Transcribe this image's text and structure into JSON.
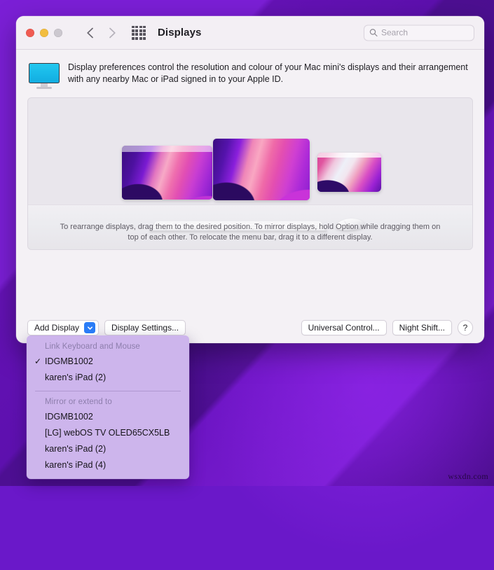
{
  "window": {
    "title": "Displays",
    "traffic_lights": [
      "close",
      "minimize",
      "zoom"
    ],
    "back_icon": "chevron-left-icon",
    "forward_icon": "chevron-right-icon",
    "grid_icon": "grid-apps-icon"
  },
  "search": {
    "placeholder": "Search",
    "value": "",
    "icon": "search-icon"
  },
  "blurb": {
    "icon": "display-monitor-icon",
    "text": "Display preferences control the resolution and colour of your Mac mini's displays and their arrangement with any nearby Mac or iPad signed in to your Apple ID."
  },
  "arrangement": {
    "hint": "To rearrange displays, drag them to the desired position. To mirror displays, hold Option while dragging them on top of each other. To relocate the menu bar, drag it to a different display.",
    "displays": [
      {
        "name": "display-1",
        "has_menu_bar": true
      },
      {
        "name": "display-2",
        "has_menu_bar": false
      },
      {
        "name": "display-3",
        "has_menu_bar": true
      }
    ],
    "peripherals": [
      "keyboard",
      "mouse"
    ]
  },
  "buttons": {
    "add_display": "Add Display",
    "add_display_chevron": "chevron-down-icon",
    "display_settings": "Display Settings...",
    "universal_control": "Universal Control...",
    "night_shift": "Night Shift...",
    "help": "?"
  },
  "menu": {
    "sections": [
      {
        "header": "Link Keyboard and Mouse",
        "items": [
          {
            "label": "IDGMB1002",
            "checked": true,
            "check_glyph": "✓"
          },
          {
            "label": "karen's iPad (2)",
            "checked": false
          }
        ]
      },
      {
        "header": "Mirror or extend to",
        "items": [
          {
            "label": "IDGMB1002",
            "checked": false
          },
          {
            "label": "[LG] webOS TV OLED65CX5LB",
            "checked": false
          },
          {
            "label": "karen's iPad (2)",
            "checked": false
          },
          {
            "label": "karen's iPad (4)",
            "checked": false
          }
        ]
      }
    ]
  },
  "desktop": {
    "watermark": "wsxdn.com"
  },
  "colors": {
    "accent_blue": "#2a7cf6",
    "menu_bg": "#cdb5ec",
    "window_bg": "#f4f1f5",
    "arrangement_bg": "#e9e6ec",
    "desktop_purple": "#6a18c9"
  }
}
